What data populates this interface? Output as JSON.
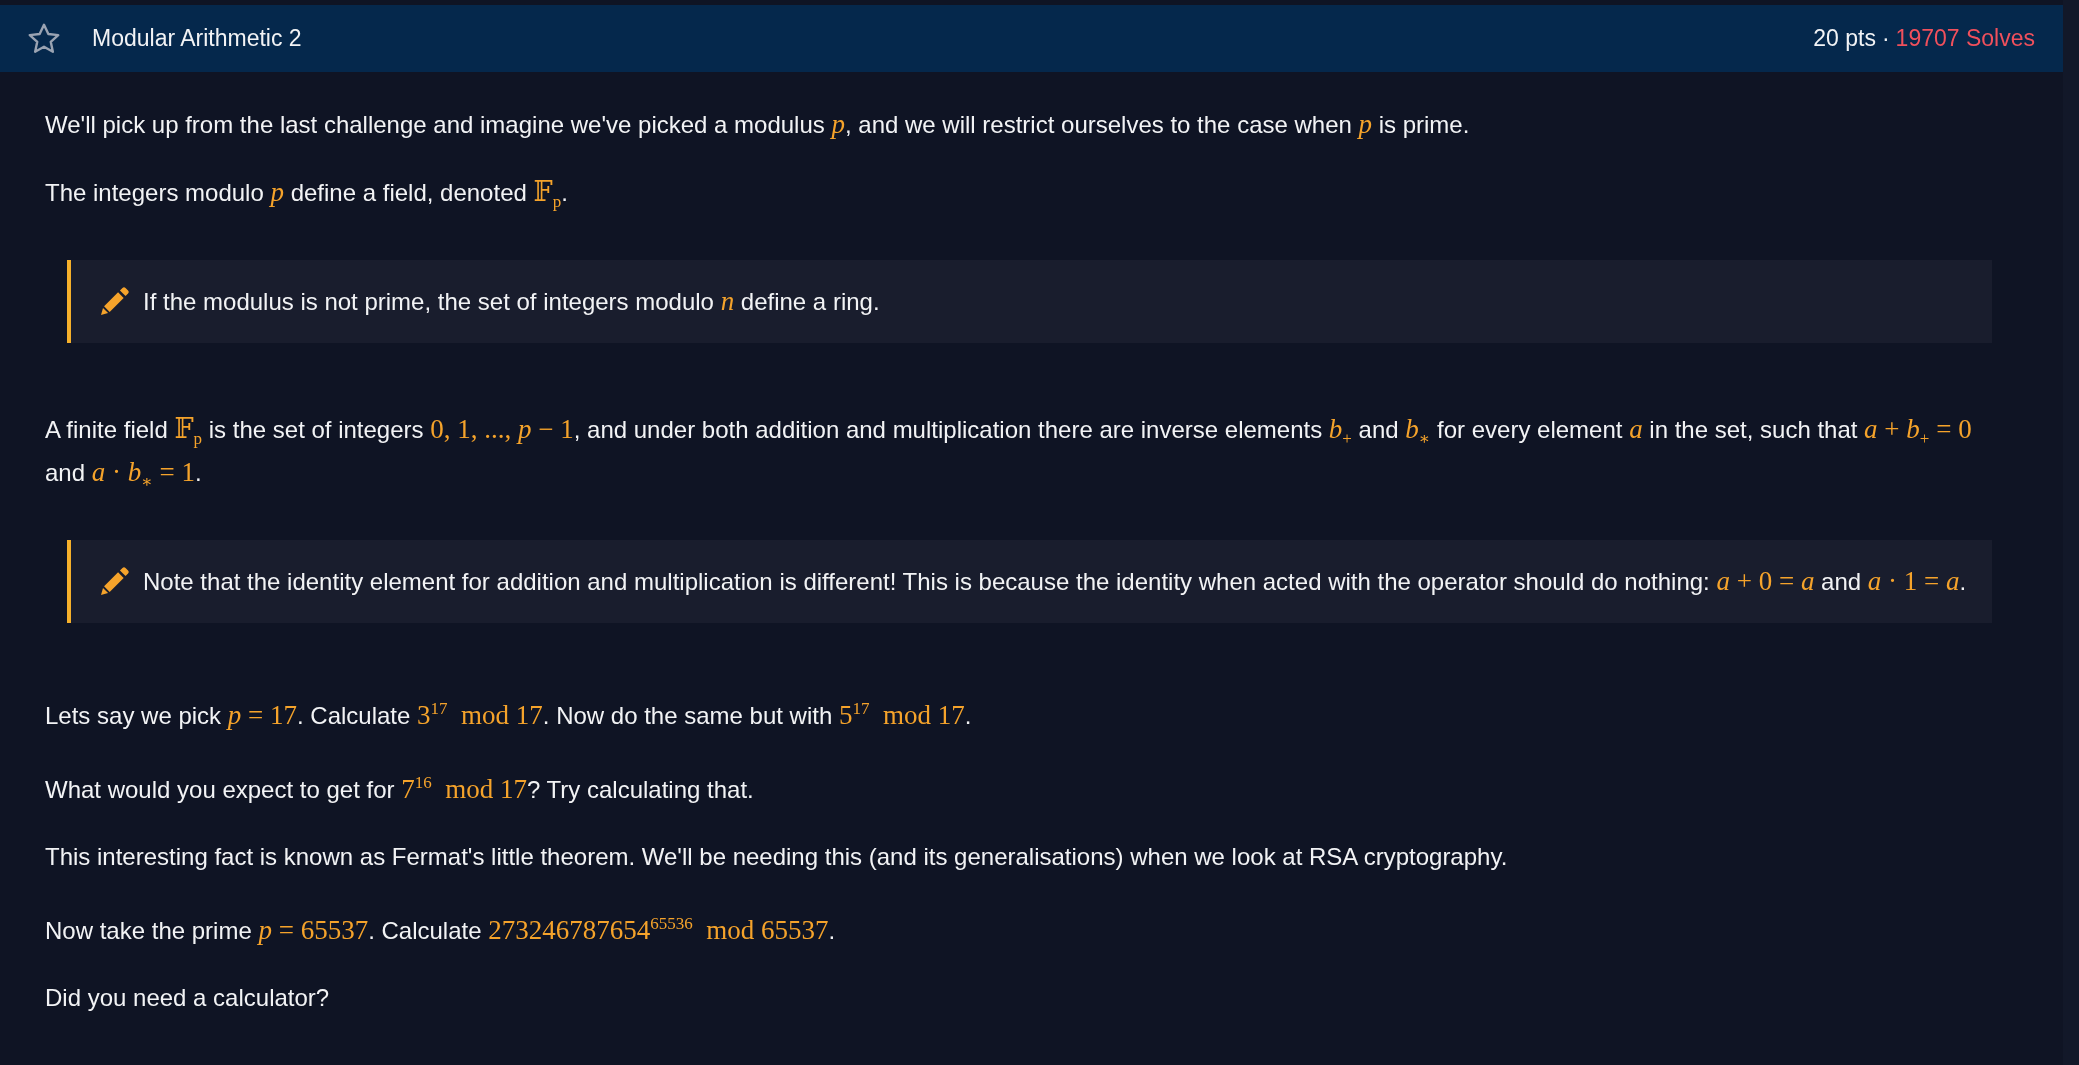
{
  "header": {
    "title": "Modular Arithmetic 2",
    "starred": false,
    "points": "20 pts",
    "separator": "·",
    "solves": "19707 Solves"
  },
  "blocks": [
    {
      "kind": "paragraph",
      "parts": [
        {
          "kind": "text",
          "text": "We'll pick up from the last challenge and imagine we've picked a modulus "
        },
        {
          "kind": "math",
          "text": "*p*"
        },
        {
          "kind": "text",
          "text": ", and we will restrict ourselves to the case when "
        },
        {
          "kind": "math",
          "text": "*p*"
        },
        {
          "kind": "text",
          "text": " is prime."
        }
      ]
    },
    {
      "kind": "paragraph",
      "parts": [
        {
          "kind": "text",
          "text": "The integers modulo "
        },
        {
          "kind": "math",
          "text": "*p*"
        },
        {
          "kind": "text",
          "text": " define a field, denoted "
        },
        {
          "kind": "math",
          "text": "𝔽$_{p}$"
        },
        {
          "kind": "text",
          "text": "."
        }
      ]
    },
    {
      "kind": "note",
      "parts": [
        {
          "kind": "text",
          "text": "If the modulus is not prime, the set of integers modulo "
        },
        {
          "kind": "math",
          "text": "*n*"
        },
        {
          "kind": "text",
          "text": " define a ring."
        }
      ]
    },
    {
      "kind": "paragraph",
      "parts": [
        {
          "kind": "text",
          "text": "A finite field "
        },
        {
          "kind": "math",
          "text": "𝔽$_{p}$"
        },
        {
          "kind": "text",
          "text": " is the set of integers "
        },
        {
          "kind": "math",
          "text": "0, 1, ..., *p* − 1"
        },
        {
          "kind": "text",
          "text": ", and under both addition and multiplication there are inverse elements "
        },
        {
          "kind": "math",
          "text": "*b*$_{+}$"
        },
        {
          "kind": "text",
          "text": " and "
        },
        {
          "kind": "math",
          "text": "*b*$_{∗}$"
        },
        {
          "kind": "text",
          "text": " for every element "
        },
        {
          "kind": "math",
          "text": "*a*"
        },
        {
          "kind": "text",
          "text": " in the set, such that "
        },
        {
          "kind": "math",
          "text": "*a* + *b*$_{+}$ = 0"
        },
        {
          "kind": "text",
          "text": " and "
        },
        {
          "kind": "math",
          "text": "*a* · *b*$_{∗}$ = 1"
        },
        {
          "kind": "text",
          "text": "."
        }
      ]
    },
    {
      "kind": "note",
      "parts": [
        {
          "kind": "text",
          "text": "Note that the identity element for addition and multiplication is different! This is because the identity when acted with the operator should do nothing: "
        },
        {
          "kind": "math",
          "text": "*a* + 0 = *a*"
        },
        {
          "kind": "text",
          "text": " and "
        },
        {
          "kind": "math",
          "text": "*a* · 1 = *a*"
        },
        {
          "kind": "text",
          "text": "."
        }
      ]
    },
    {
      "kind": "paragraph",
      "parts": [
        {
          "kind": "text",
          "text": "Lets say we pick "
        },
        {
          "kind": "math",
          "text": "*p* = 17"
        },
        {
          "kind": "text",
          "text": ". Calculate "
        },
        {
          "kind": "math",
          "text": "3$^{17}$  mod 17"
        },
        {
          "kind": "text",
          "text": ". Now do the same but with "
        },
        {
          "kind": "math",
          "text": "5$^{17}$  mod 17"
        },
        {
          "kind": "text",
          "text": "."
        }
      ]
    },
    {
      "kind": "paragraph",
      "parts": [
        {
          "kind": "text",
          "text": "What would you expect to get for "
        },
        {
          "kind": "math",
          "text": "7$^{16}$  mod 17"
        },
        {
          "kind": "text",
          "text": "? Try calculating that."
        }
      ]
    },
    {
      "kind": "paragraph",
      "parts": [
        {
          "kind": "text",
          "text": "This interesting fact is known as Fermat's little theorem. We'll be needing this (and its generalisations) when we look at RSA cryptography."
        }
      ]
    },
    {
      "kind": "paragraph",
      "parts": [
        {
          "kind": "text",
          "text": "Now take the prime "
        },
        {
          "kind": "math",
          "text": "*p* = 65537"
        },
        {
          "kind": "text",
          "text": ". Calculate "
        },
        {
          "kind": "math",
          "text": "273246787654$^{65536}$  mod 65537"
        },
        {
          "kind": "text",
          "text": "."
        }
      ]
    },
    {
      "kind": "paragraph",
      "parts": [
        {
          "kind": "text",
          "text": "Did you need a calculator?"
        }
      ]
    }
  ]
}
